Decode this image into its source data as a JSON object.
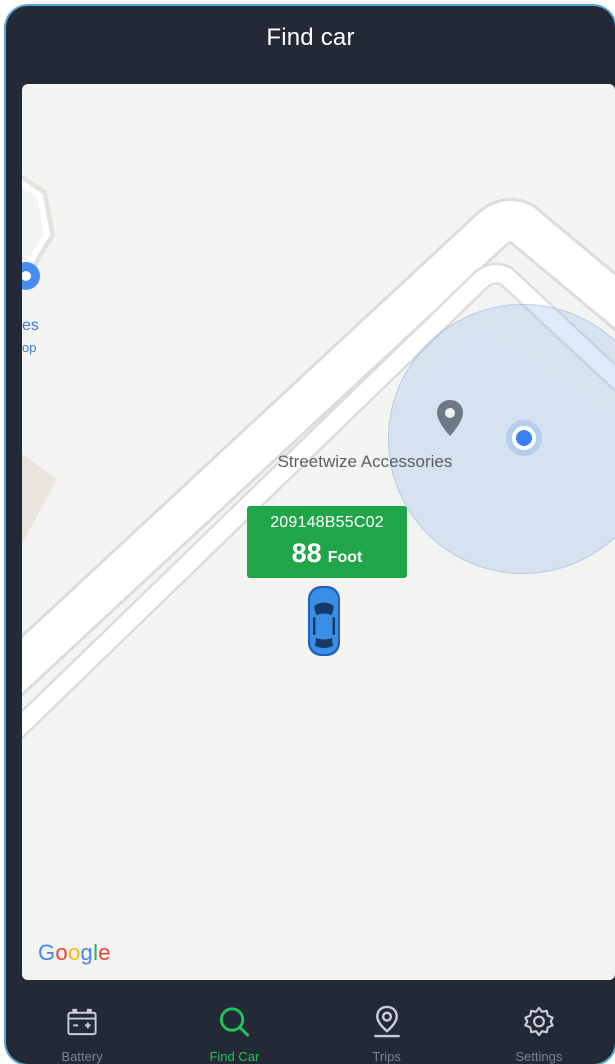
{
  "header": {
    "title": "Find car"
  },
  "map": {
    "poi_left": {
      "label_line1": "es",
      "label_line2": "op"
    },
    "place_label": "Streetwize Accessories",
    "car": {
      "id": "209148B55C02",
      "distance_value": "88",
      "distance_unit": "Foot"
    },
    "attribution": [
      "G",
      "o",
      "o",
      "g",
      "l",
      "e"
    ],
    "colors": {
      "badge": "#21a54a",
      "user_dot": "#3b7ff0",
      "car": "#3a8ee6"
    }
  },
  "tabs": [
    {
      "label": "Battery",
      "icon": "battery-icon",
      "active": false
    },
    {
      "label": "Find Car",
      "icon": "search-icon",
      "active": true
    },
    {
      "label": "Trips",
      "icon": "location-pin-icon",
      "active": false
    },
    {
      "label": "Settings",
      "icon": "gear-icon",
      "active": false
    }
  ],
  "colors": {
    "active_tab": "#23c25a",
    "inactive_tab": "#7b8390",
    "background": "#232a36"
  }
}
